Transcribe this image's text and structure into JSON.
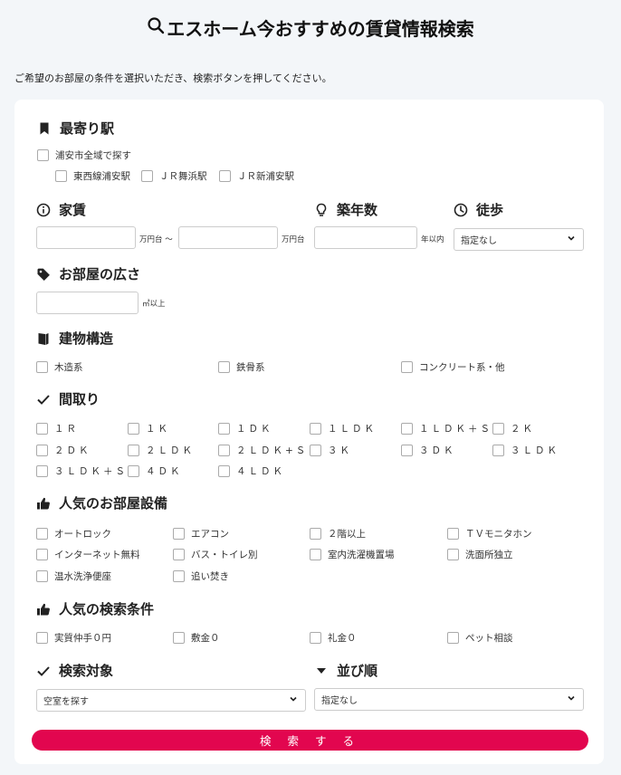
{
  "title": "エスホーム今おすすめの賃貸情報検索",
  "intro": "ご希望のお部屋の条件を選択いただき、検索ボタンを押してください。",
  "station": {
    "heading": "最寄り駅",
    "all_label": "浦安市全域で探す",
    "items": [
      "東西線浦安駅",
      "ＪＲ舞浜駅",
      "ＪＲ新浦安駅"
    ]
  },
  "rent": {
    "heading": "家賃",
    "unit1": "万円台 〜",
    "unit2": "万円台",
    "min_value": "",
    "max_value": ""
  },
  "age": {
    "heading": "築年数",
    "unit": "年以内",
    "value": ""
  },
  "walk": {
    "heading": "徒歩",
    "selected": "指定なし"
  },
  "area": {
    "heading": "お部屋の広さ",
    "unit": "㎡以上",
    "value": ""
  },
  "structure": {
    "heading": "建物構造",
    "items": [
      "木造系",
      "鉄骨系",
      "コンクリート系・他"
    ]
  },
  "layout": {
    "heading": "間取り",
    "items": [
      "１Ｒ",
      "１Ｋ",
      "１ＤＫ",
      "１ＬＤＫ",
      "１ＬＤＫ＋Ｓ",
      "２Ｋ",
      "２ＤＫ",
      "２ＬＤＫ",
      "２ＬＤＫ+Ｓ",
      "３Ｋ",
      "３ＤＫ",
      "３ＬＤＫ",
      "３ＬＤＫ＋Ｓ",
      "４ＤＫ",
      "４ＬＤＫ"
    ]
  },
  "equipment": {
    "heading": "人気のお部屋設備",
    "items": [
      "オートロック",
      "エアコン",
      "２階以上",
      "ＴＶモニタホン",
      "インターネット無料",
      "バス・トイレ別",
      "室内洗濯機置場",
      "洗面所独立",
      "温水洗浄便座",
      "追い焚き"
    ]
  },
  "conditions": {
    "heading": "人気の検索条件",
    "items": [
      "実質仲手０円",
      "敷金０",
      "礼金０",
      "ペット相談"
    ]
  },
  "target": {
    "heading": "検索対象",
    "selected": "空室を探す"
  },
  "order": {
    "heading": "並び順",
    "selected": "指定なし"
  },
  "search_button": "検 索 す る"
}
